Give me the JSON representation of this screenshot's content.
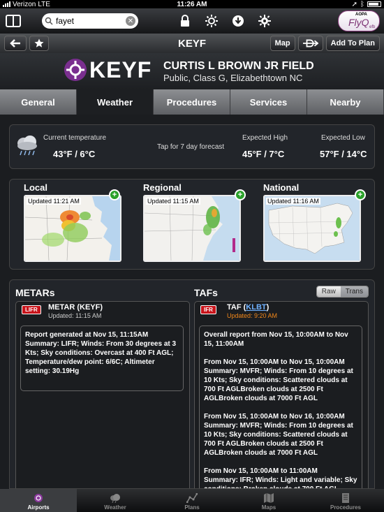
{
  "status_bar": {
    "carrier": "Verizon",
    "network": "LTE",
    "time": "11:26 AM"
  },
  "toolbar": {
    "search_value": "fayet",
    "logo_small": "AOPA",
    "logo_text": "FlyQ",
    "logo_sub": "efb"
  },
  "nav": {
    "title": "KEYF",
    "map_label": "Map",
    "add_label": "Add To Plan"
  },
  "airport": {
    "code": "KEYF",
    "name": "CURTIS L BROWN JR FIELD",
    "details": "Public, Class G, Elizabethtown NC"
  },
  "tabs": [
    {
      "label": "General"
    },
    {
      "label": "Weather"
    },
    {
      "label": "Procedures"
    },
    {
      "label": "Services"
    },
    {
      "label": "Nearby"
    }
  ],
  "weather": {
    "current_label": "Current temperature",
    "current_value": "43°F / 6°C",
    "tap_label": "Tap for 7 day forecast",
    "high_label": "Expected High",
    "high_value": "45°F / 7°C",
    "low_label": "Expected Low",
    "low_value": "57°F / 14°C"
  },
  "maps": [
    {
      "title": "Local",
      "updated": "Updated 11:21 AM"
    },
    {
      "title": "Regional",
      "updated": "Updated 11:15 AM"
    },
    {
      "title": "National",
      "updated": "Updated 11:16 AM"
    }
  ],
  "metars": {
    "title": "METARs",
    "badge": "LIFR",
    "report_title": "METAR (KEYF)",
    "updated": "Updated: 11:15 AM",
    "text": "Report generated at Nov 15, 11:15AM\nSummary: LIFR; Winds: From 30 degrees at 3 Kts; Sky conditions: Overcast  at 400 Ft AGL; Temperature/dew point: 6/6C; Altimeter setting: 30.19Hg"
  },
  "tafs": {
    "title": "TAFs",
    "raw_label": "Raw",
    "trans_label": "Trans",
    "badge": "IFR",
    "report_title_prefix": "TAF (",
    "report_link": "KLBT",
    "report_title_suffix": ")",
    "updated": "Updated: 9:20 AM",
    "text": "Overall report from Nov 15, 10:00AM to Nov 15, 11:00AM\n\nFrom Nov 15, 10:00AM to Nov 15, 10:00AM\nSummary: MVFR; Winds: From 10 degrees at 10 Kts; Sky conditions: Scattered clouds  at 700 Ft AGLBroken clouds  at 2500 Ft AGLBroken clouds  at 7000 Ft AGL\n\nFrom Nov 15, 10:00AM to Nov 16, 10:00AM\nSummary: MVFR; Winds: From 10 degrees at 10 Kts; Sky conditions: Scattered clouds  at 700 Ft AGLBroken clouds  at 2500 Ft AGLBroken clouds  at 7000 Ft AGL\n\nFrom Nov 15, 10:00AM to 11:00AM\nSummary: IFR; Winds: Light and variable; Sky conditions: Broken clouds  at 700 Ft AGL"
  },
  "bottom_tabs": [
    {
      "label": "Airports"
    },
    {
      "label": "Weather"
    },
    {
      "label": "Plans"
    },
    {
      "label": "Maps"
    },
    {
      "label": "Procedures"
    }
  ],
  "colors": {
    "lifr_badge": "#c8141b",
    "updated_orange": "#f1871a",
    "link_blue": "#6fb1ff",
    "brand_purple": "#7a2f8f",
    "add_green": "#2aa12a"
  }
}
